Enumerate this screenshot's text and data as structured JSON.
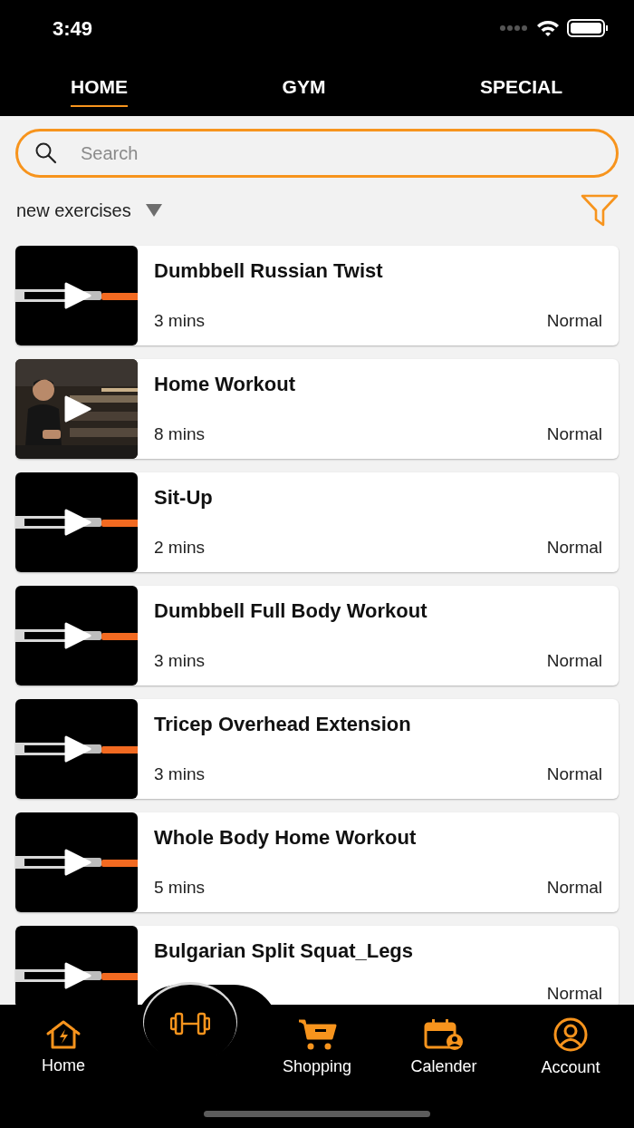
{
  "status_bar": {
    "time": "3:49"
  },
  "tabs": [
    {
      "label": "HOME",
      "selected": true
    },
    {
      "label": "GYM",
      "selected": false
    },
    {
      "label": "SPECIAL",
      "selected": false
    }
  ],
  "search": {
    "placeholder": "Search"
  },
  "sort": {
    "label": "new exercises"
  },
  "exercises": [
    {
      "title": "Dumbbell Russian Twist",
      "duration": "3 mins",
      "level_label": "Normal"
    },
    {
      "title": "Home Workout",
      "duration": "8 mins",
      "level_label": "Normal"
    },
    {
      "title": "Sit-Up",
      "duration": "2 mins",
      "level_label": "Normal"
    },
    {
      "title": "Dumbbell Full Body Workout",
      "duration": "3 mins",
      "level_label": "Normal"
    },
    {
      "title": "Tricep Overhead Extension",
      "duration": "3 mins",
      "level_label": "Normal"
    },
    {
      "title": "Whole Body Home Workout",
      "duration": "5 mins",
      "level_label": "Normal"
    },
    {
      "title": "Bulgarian Split Squat_Legs",
      "level_label": "Normal"
    }
  ],
  "bottom_nav": [
    {
      "kind": "home",
      "label": "Home"
    },
    {
      "kind": "gym"
    },
    {
      "kind": "cart",
      "label": "Shopping"
    },
    {
      "kind": "calendar",
      "label": "Calender"
    },
    {
      "kind": "account",
      "label": "Account"
    }
  ]
}
